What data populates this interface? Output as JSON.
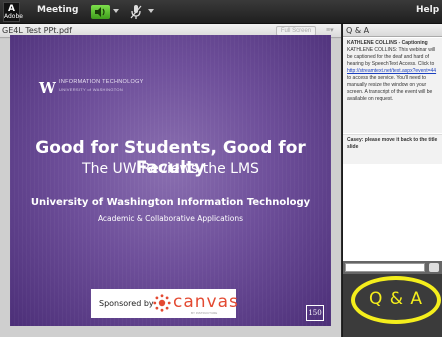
{
  "menubar": {
    "logo_text": "Adobe",
    "meeting_label": "Meeting",
    "help_label": "Help"
  },
  "share_pod": {
    "title": "GE4L Test PPt.pdf",
    "fullscreen_label": "Full Screen",
    "menu_label": "≡▾"
  },
  "slide": {
    "org_short": "INFORMATION TECHNOLOGY",
    "org_sub": "UNIVERSITY of WASHINGTON",
    "title": "Good for Students, Good for Faculty",
    "subtitle": "The UW Reviews the LMS",
    "org_line": "University of Washington Information Technology",
    "dept_line": "Academic & Collaborative Applications",
    "sponsor_label": "Sponsored by",
    "sponsor_brand": "canvas",
    "sponsor_tagline": "BY INSTRUCTURE",
    "badge": "150"
  },
  "qa_pod": {
    "title": "Q & A",
    "items": [
      {
        "title": "KATHLENE COLLINS - Captioning",
        "text_before": "KATHLENE COLLINS: This webinar will be captioned for the deaf and hard of hearing by SpeechText Access. Click to ",
        "link": "http://streamtext.net/text.aspx?event=44",
        "text_after": " to access the service. You'll need to manually resize the window on your screen. A transcript of the event will be available on request."
      },
      {
        "title": "Casey: please move it back to the title slide",
        "text_before": "",
        "link": "",
        "text_after": ""
      }
    ],
    "overlay_label": "Q & A"
  },
  "colors": {
    "accent_yellow": "#f4ee1c",
    "slide_purple": "#6e4f9a",
    "canvas_red": "#e34a32",
    "speaker_green": "#4caf28"
  },
  "icons": {
    "speaker": "speaker-icon",
    "microphone": "microphone-icon",
    "canvas_logo": "canvas-logo-icon"
  }
}
